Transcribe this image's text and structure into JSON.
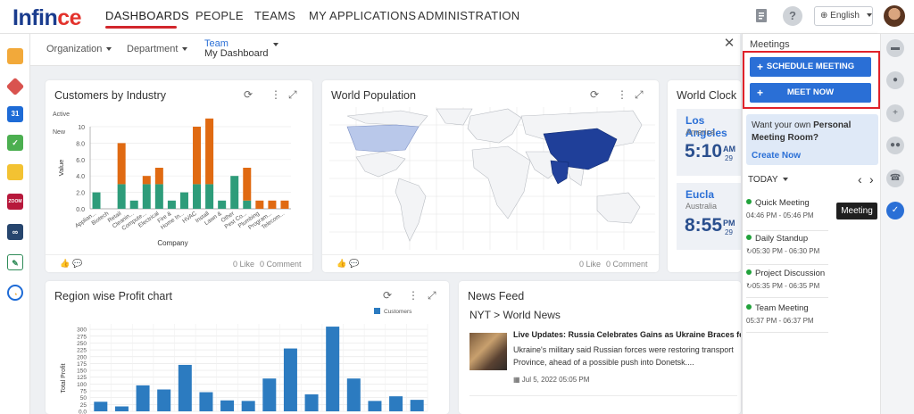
{
  "logo": {
    "part1": "Infin",
    "part2": "ce"
  },
  "nav": {
    "items": [
      "DASHBOARDS",
      "PEOPLE",
      "TEAMS",
      "MY APPLICATIONS",
      "ADMINISTRATION"
    ]
  },
  "topbar": {
    "help": "?",
    "language": "English"
  },
  "filters": {
    "organization": "Organization",
    "department": "Department",
    "team": "Team",
    "dashboard": "My Dashboard"
  },
  "cards": {
    "customers": {
      "title": "Customers by Industry",
      "likes": "0 Like",
      "comments": "0 Comment"
    },
    "population": {
      "title": "World Population",
      "likes": "0 Like",
      "comments": "0 Comment"
    },
    "clock": {
      "title": "World Clock",
      "city1": "Los Angeles",
      "region1": "America",
      "time1": "5:10",
      "ampm1": "AM",
      "day1": "29",
      "city2": "Eucla",
      "region2": "Australia",
      "time2": "8:55",
      "ampm2": "PM",
      "day2": "29"
    },
    "profit": {
      "title": "Region wise Profit chart"
    },
    "news": {
      "title": "News Feed",
      "source": "NYT > World News",
      "headline": "Live Updates: Russia Celebrates Gains as Ukraine Braces for N",
      "summary1": "Ukraine's military said Russian forces were restoring transport",
      "summary2": "Province, ahead of a possible push into Donetsk....",
      "date": "Jul 5, 2022 05:05 PM"
    }
  },
  "meetings": {
    "title": "Meetings",
    "schedule_label": "SCHEDULE MEETING",
    "meet_label": "MEET NOW",
    "promo_text1": "Want your own ",
    "promo_bold": "Personal",
    "promo_text2": "Meeting Room?",
    "promo_link": "Create Now",
    "today": "TODAY",
    "list": [
      {
        "name": "Quick Meeting",
        "time": "04:46 PM - 05:46 PM"
      },
      {
        "name": "Daily Standup",
        "time": "05:30 PM - 06:30 PM"
      },
      {
        "name": "Project Discussion",
        "time": "05:35 PM - 06:35 PM"
      },
      {
        "name": "Team Meeting",
        "time": "05:37 PM - 06:37 PM"
      }
    ]
  },
  "tooltip": "Meeting",
  "chart_data": [
    {
      "type": "bar",
      "title": "Customers by Industry",
      "xlabel": "Company",
      "ylabel": "Value",
      "legend": [
        "Active",
        "New"
      ],
      "ylim": [
        0,
        10
      ],
      "yticks": [
        "0.0",
        "2.0",
        "4.0",
        "6.0",
        "8.0",
        "10"
      ],
      "categories": [
        "Applian...",
        "Biotech",
        "Retail",
        "Cleanin...",
        "Compute...",
        "Electrical",
        "Fire &",
        "Home In...",
        "HVAC",
        "Install",
        "Lawn &",
        "Other",
        "Pest Co...",
        "Plumbing",
        "Program...",
        "Telecom..."
      ],
      "series": [
        {
          "name": "Active",
          "color": "#2e9c7a",
          "values": [
            2,
            0,
            3,
            1,
            3,
            3,
            1,
            2,
            3,
            3,
            1,
            4,
            1,
            0,
            0,
            0
          ]
        },
        {
          "name": "New",
          "color": "#e06a12",
          "values": [
            0,
            0,
            5,
            0,
            1,
            2,
            0,
            0,
            7,
            8,
            0,
            0,
            4,
            1,
            1,
            1
          ]
        }
      ]
    },
    {
      "type": "bar",
      "title": "Region wise Profit chart",
      "ylabel": "Total Profit",
      "ylim": [
        0,
        320
      ],
      "yticks": [
        "0.0",
        "25",
        "50",
        "75",
        "100",
        "125",
        "150",
        "175",
        "200",
        "225",
        "250",
        "275",
        "300"
      ],
      "series": [
        {
          "name": "Customers",
          "color": "#2c7bc0",
          "values": [
            35,
            18,
            95,
            80,
            170,
            70,
            40,
            38,
            120,
            230,
            62,
            310,
            120,
            38,
            55,
            42
          ]
        }
      ]
    }
  ]
}
